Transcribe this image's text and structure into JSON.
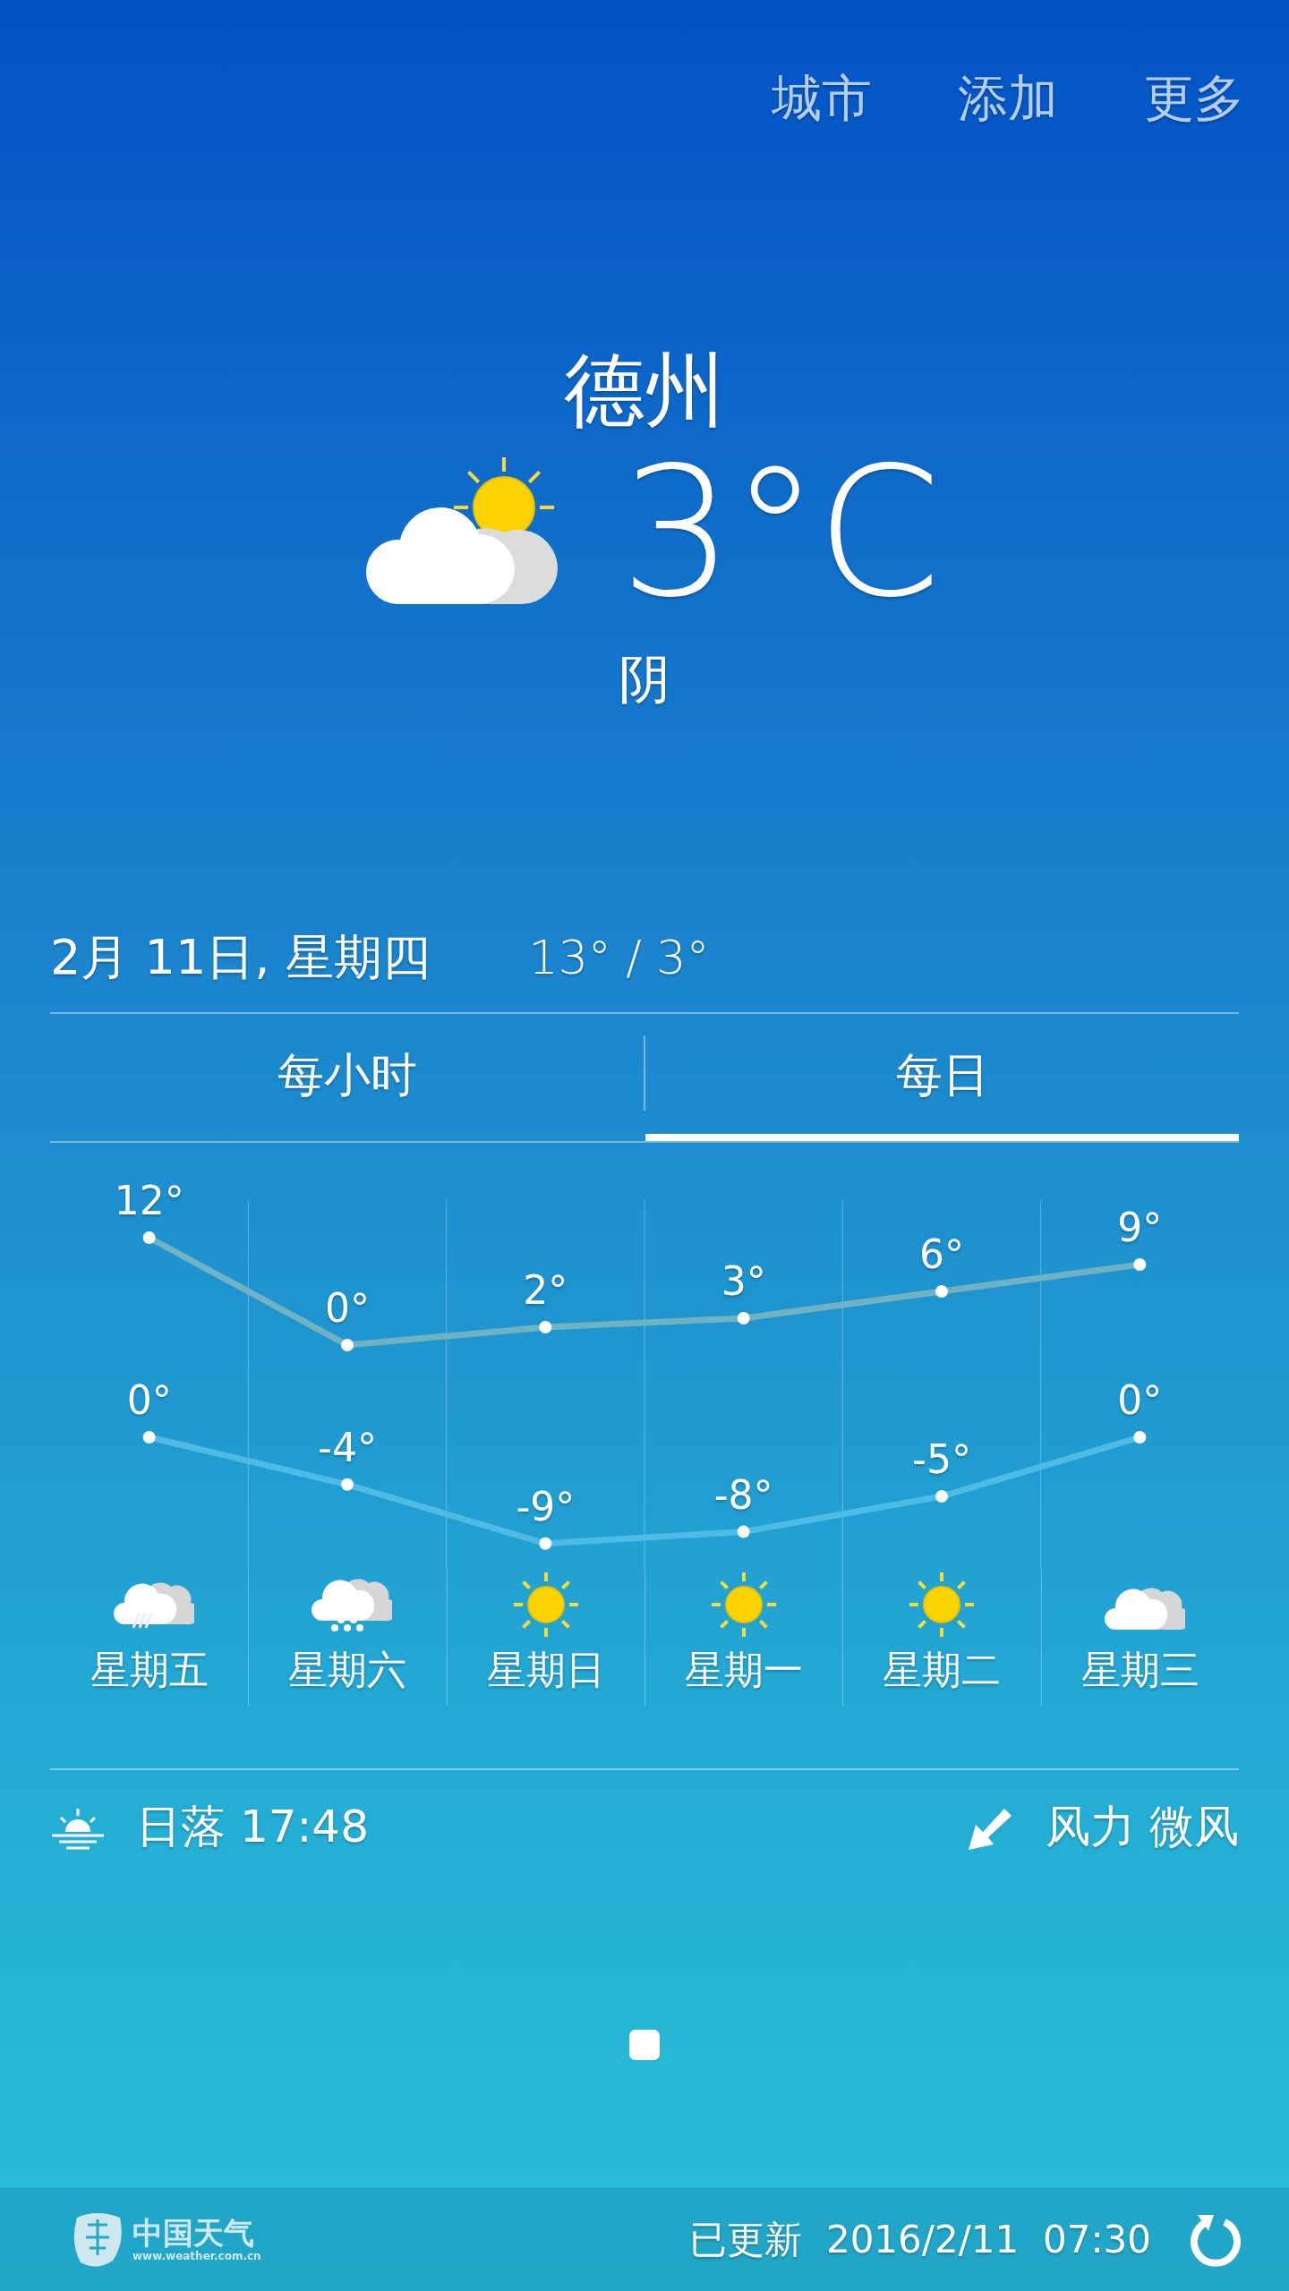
{
  "header": {
    "links": [
      "城市",
      "添加",
      "更多"
    ]
  },
  "current": {
    "city": "德州",
    "kind": "partly_cloudy",
    "temperature": "3°C",
    "condition": "阴"
  },
  "summary": {
    "date": "2月 11日, 星期四",
    "range": "13° / 3°"
  },
  "tabs": [
    {
      "label": "每小时",
      "selected": false
    },
    {
      "label": "每日",
      "selected": true
    }
  ],
  "forecast": {
    "highs": {
      "chart_data": {
        "type": "line",
        "series": [
          {
            "color": "#6fb2c4",
            "marker": "circle",
            "values": [
              12,
              0,
              2,
              3,
              6,
              9
            ],
            "value_labels": [
              "12°",
              "0°",
              "2°",
              "3°",
              "6°",
              "9°"
            ]
          }
        ]
      }
    },
    "lows": {
      "chart_data": {
        "type": "line",
        "series": [
          {
            "color": "#4dbbe6",
            "marker": "circle",
            "values": [
              0,
              -4,
              -9,
              -8,
              -5,
              0
            ],
            "value_labels": [
              "0°",
              "-4°",
              "-9°",
              "-8°",
              "-5°",
              "0°"
            ]
          }
        ]
      }
    },
    "days": [
      {
        "kind": "rain",
        "label": "星期五"
      },
      {
        "kind": "snow",
        "label": "星期六"
      },
      {
        "kind": "sun",
        "label": "星期日"
      },
      {
        "kind": "sun",
        "label": "星期一"
      },
      {
        "kind": "sun",
        "label": "星期二"
      },
      {
        "kind": "cloud",
        "label": "星期三"
      }
    ]
  },
  "details": {
    "sunset": "日落 17:48",
    "wind": "风力 微风"
  },
  "footer": {
    "logo_name": "中国天气",
    "logo_url": "www.weather.com.cn",
    "updated": "已更新  2016/2/11  07:30"
  }
}
